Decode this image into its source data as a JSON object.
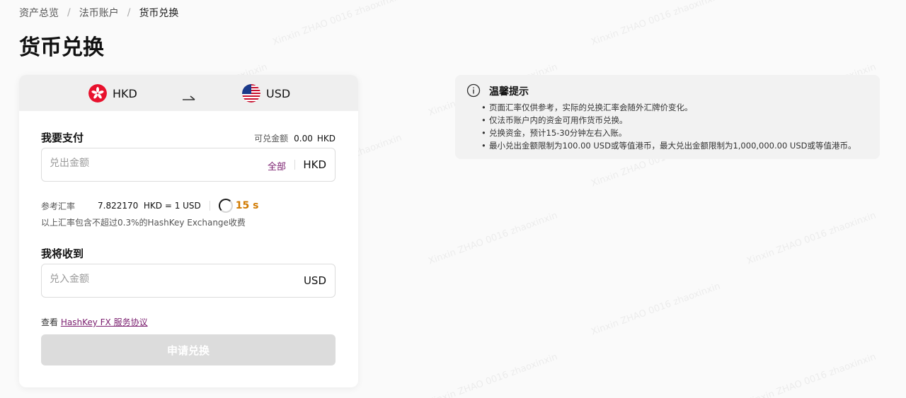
{
  "breadcrumb": {
    "items": [
      "资产总览",
      "法币账户",
      "货币兑换"
    ],
    "separator": "/"
  },
  "page_title": "货币兑换",
  "currency_bar": {
    "from_code": "HKD",
    "to_code": "USD",
    "from_flag_icon": "hong-kong-flag-icon",
    "to_flag_icon": "us-flag-icon"
  },
  "pay": {
    "label": "我要支付",
    "available_label": "可兑金额",
    "available_amount": "0.00",
    "available_currency": "HKD",
    "placeholder": "兑出金额",
    "all_label": "全部",
    "unit": "HKD"
  },
  "rate": {
    "label": "参考汇率",
    "value": "7.822170  HKD = 1 USD",
    "countdown": "15 s",
    "note": "以上汇率包含不超过0.3%的HashKey Exchange收费"
  },
  "receive": {
    "label": "我将收到",
    "placeholder": "兑入金额",
    "unit": "USD"
  },
  "agreement": {
    "prefix": "查看 ",
    "link_text": "HashKey FX 服务协议"
  },
  "submit_label": "申请兑换",
  "tips": {
    "title": "温馨提示",
    "items": [
      "页面汇率仅供参考，实际的兑换汇率会随外汇牌价变化。",
      "仅法币账户内的资金可用作货币兑换。",
      "兑换资金，预计15-30分钟左右入账。",
      "最小兑出金额限制为100.00 USD或等值港币，最大兑出金额限制为1,000,000.00 USD或等值港币。"
    ]
  },
  "watermark_text": "Xinxin ZHAO 0016 zhaoxinxin",
  "colors": {
    "accent": "#7a1d6e",
    "countdown": "#d17a00",
    "disabled_button": "#dcdcdc"
  }
}
